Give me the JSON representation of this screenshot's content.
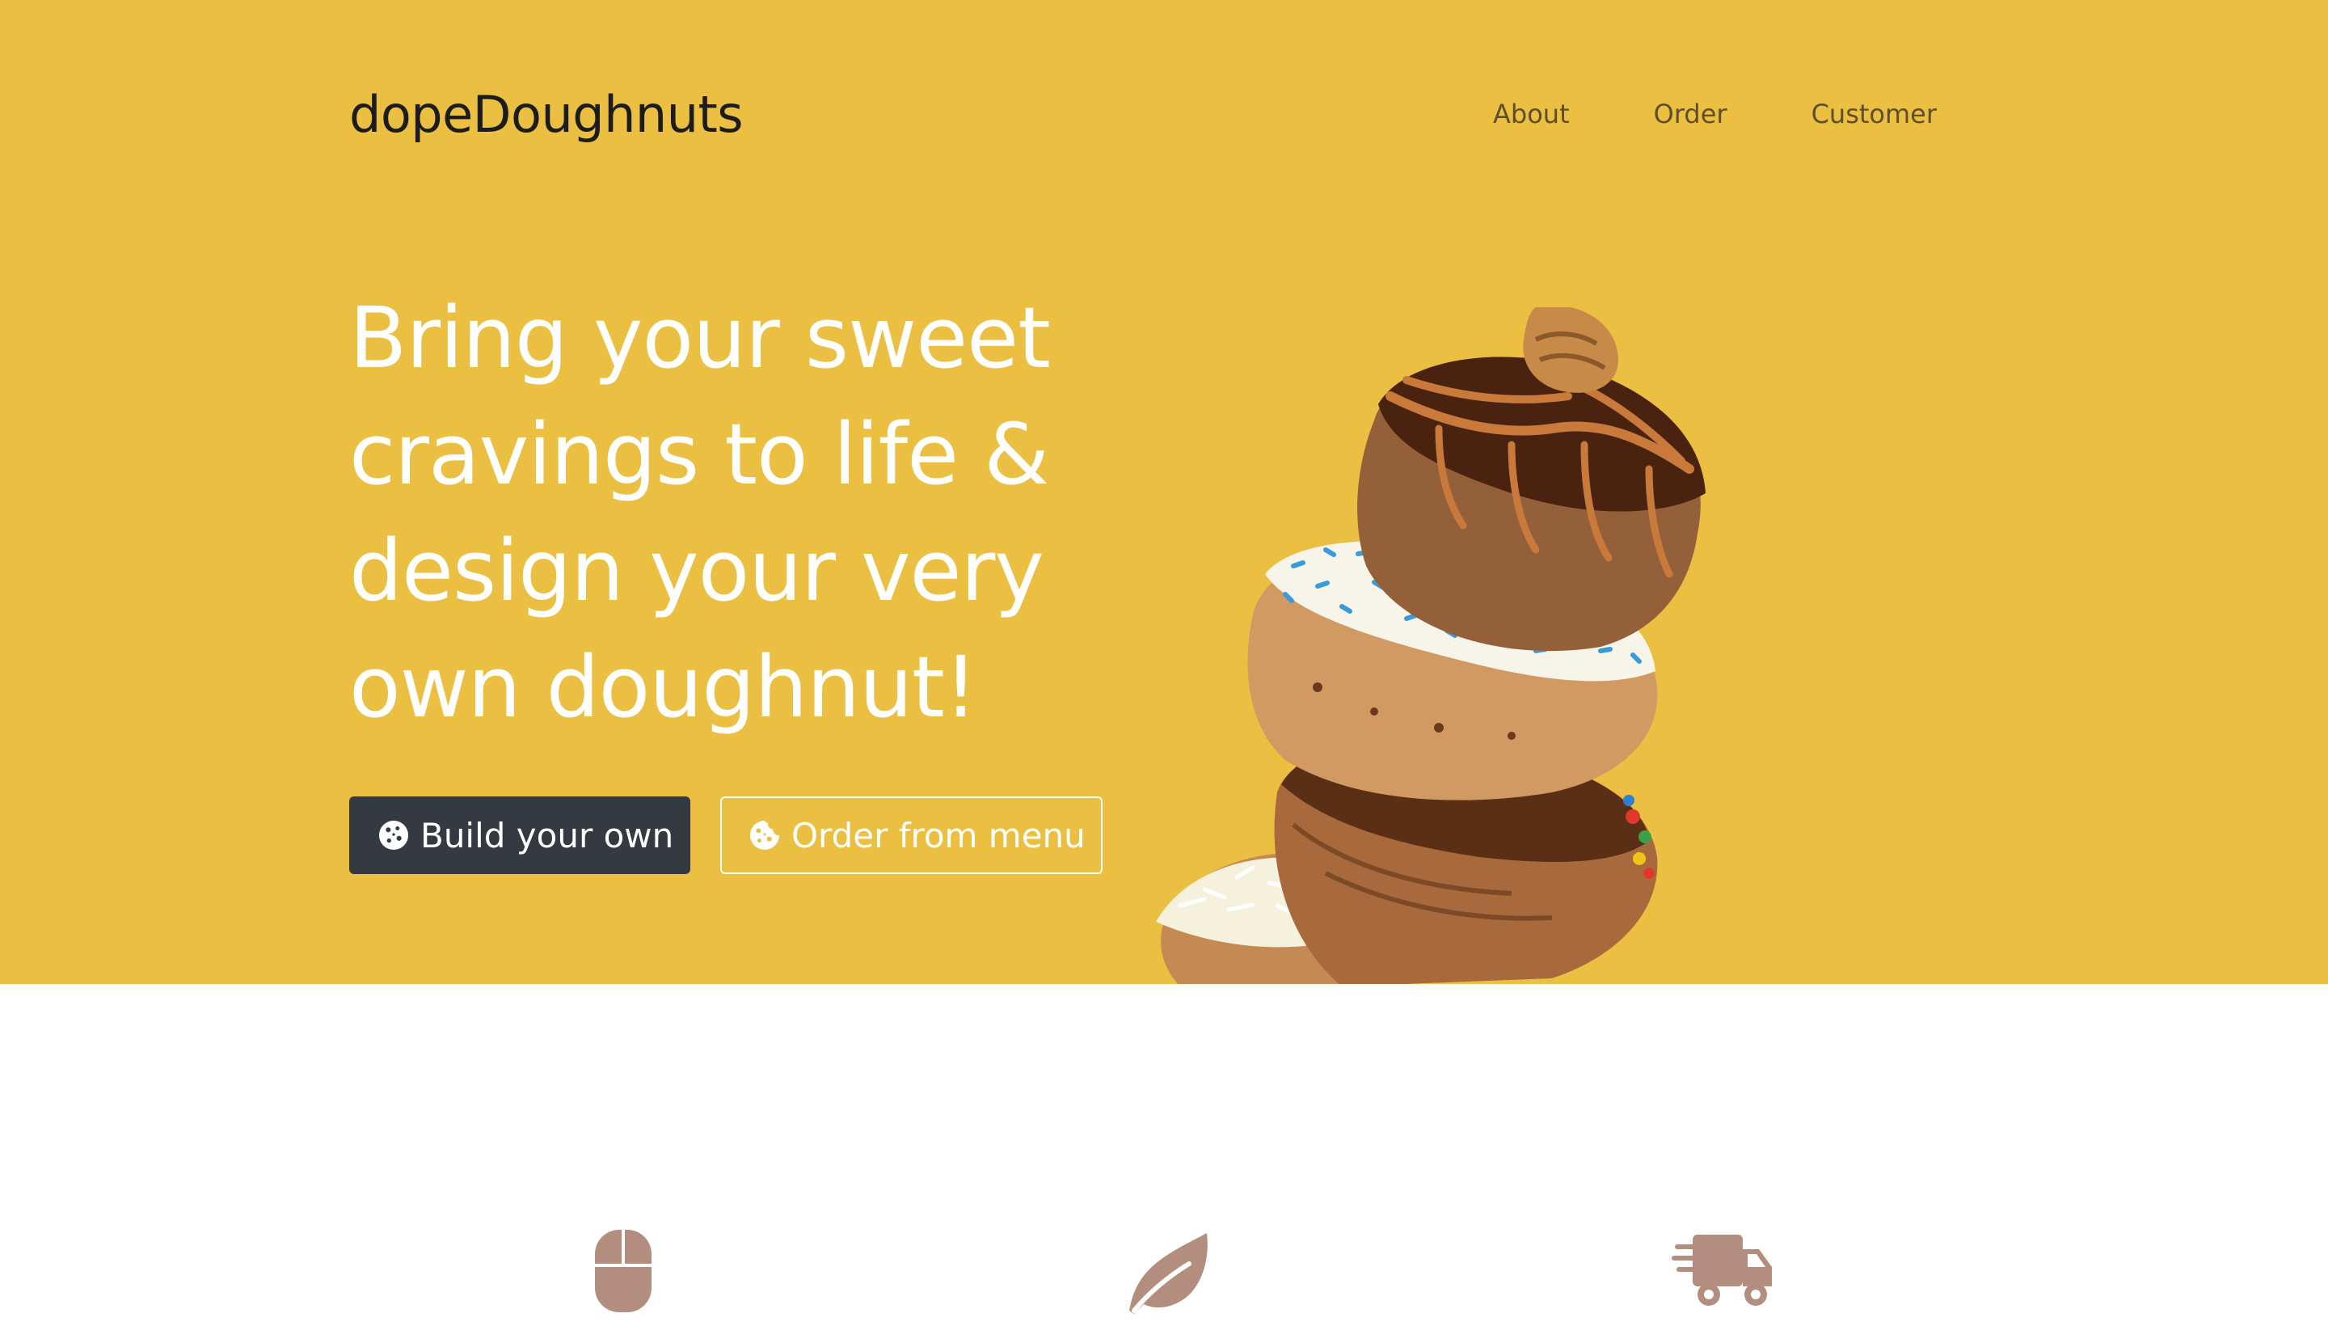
{
  "header": {
    "brand": "dopeDoughnuts",
    "nav": [
      {
        "label": "About"
      },
      {
        "label": "Order"
      },
      {
        "label": "Customer"
      }
    ]
  },
  "hero": {
    "headline_lines": [
      "Bring your sweet",
      "cravings to life &",
      "design your very",
      "own doughnut!"
    ],
    "build_button": {
      "label": "Build your own",
      "icon": "cookie-icon"
    },
    "menu_button": {
      "label": "Order from menu",
      "icon": "cookie-bite-icon"
    },
    "image": "stacked-doughnuts-image",
    "background_color": "#ebbf41"
  },
  "features": {
    "icons": [
      "mouse-icon",
      "leaf-icon",
      "shipping-fast-icon"
    ],
    "icon_color": "#b38e7e"
  }
}
